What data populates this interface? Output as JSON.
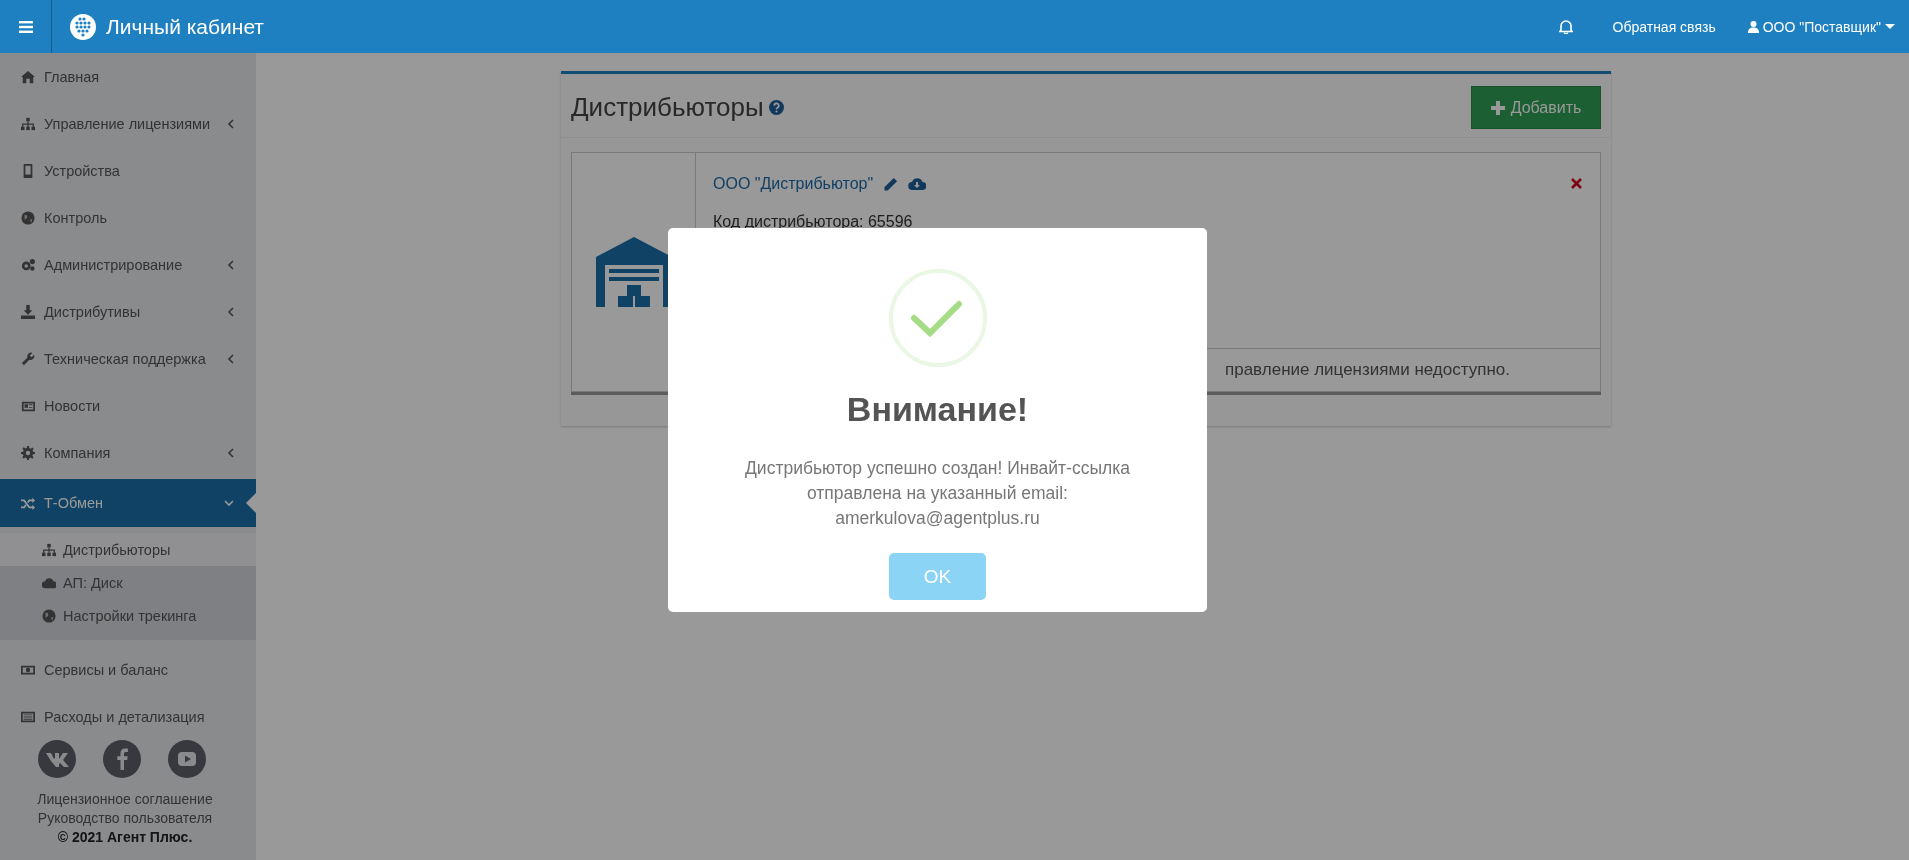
{
  "topbar": {
    "title": "Личный кабинет",
    "feedback": "Обратная связь",
    "user": "ООО \"Поставщик\""
  },
  "sidebar": {
    "items": [
      {
        "label": "Главная",
        "expandable": false,
        "selected": false
      },
      {
        "label": "Управление лицензиями",
        "expandable": true,
        "expanded": false,
        "selected": false
      },
      {
        "label": "Устройства",
        "expandable": false,
        "selected": false
      },
      {
        "label": "Контроль",
        "expandable": false,
        "selected": false
      },
      {
        "label": "Администрирование",
        "expandable": true,
        "expanded": false,
        "selected": false
      },
      {
        "label": "Дистрибутивы",
        "expandable": true,
        "expanded": false,
        "selected": false
      },
      {
        "label": "Техническая поддержка",
        "expandable": true,
        "expanded": false,
        "selected": false
      },
      {
        "label": "Новости",
        "expandable": false,
        "selected": false
      },
      {
        "label": "Компания",
        "expandable": true,
        "expanded": false,
        "selected": false
      },
      {
        "label": "Т-Обмен",
        "expandable": true,
        "expanded": true,
        "selected": true,
        "children": [
          {
            "label": "Дистрибьюторы",
            "selected": true
          },
          {
            "label": "АП: Диск",
            "selected": false
          },
          {
            "label": "Настройки трекинга",
            "selected": false
          }
        ]
      },
      {
        "label": "Сервисы и баланс",
        "expandable": false,
        "selected": false
      },
      {
        "label": "Расходы и детализация",
        "expandable": false,
        "selected": false
      }
    ],
    "footer_links": [
      "Лицензионное соглашение",
      "Руководство пользователя"
    ],
    "copyright": "© 2021 Агент Плюс."
  },
  "panel": {
    "title": "Дистрибьюторы",
    "add_button": "Добавить",
    "distributor": {
      "name": "ООО \"Дистрибьютор\"",
      "code": "Код дистрибьютора: 65596",
      "note": "правление лицензиями недоступно."
    }
  },
  "modal": {
    "title": "Внимание!",
    "message": "Дистрибьютор успешно создан! Инвайт-ссылка отправлена на указанный email: amerkulova@agentplus.ru",
    "button": "OK"
  }
}
